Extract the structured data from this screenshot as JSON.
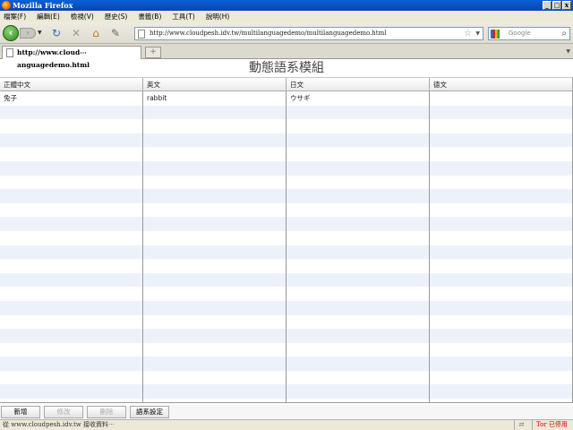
{
  "window": {
    "title": "Mozilla Firefox",
    "minimize": "_",
    "restore": "□",
    "close": "x"
  },
  "menu": [
    "檔案(F)",
    "編輯(E)",
    "檢視(V)",
    "歷史(S)",
    "書籤(B)",
    "工具(T)",
    "說明(H)"
  ],
  "nav": {
    "url": "http://www.cloudpesh.idv.tw/multilanguagedemo/multilanguagedemo.html",
    "search_placeholder": "Google"
  },
  "tab": {
    "label": "http://www.cloud⋯anguagedemo.html",
    "new_tab": "+"
  },
  "app": {
    "title": "動態語系模組",
    "columns": [
      "正體中文",
      "英文",
      "日文",
      "德文"
    ],
    "rows": [
      [
        "兔子",
        "rabbit",
        "ウサギ",
        ""
      ]
    ],
    "buttons": {
      "add": "新增",
      "edit": "修改",
      "delete": "刪除",
      "settings": "語系設定"
    }
  },
  "status": {
    "text": "從 www.cloudpesh.idv.tw 接收資料⋯",
    "tor": "Tor 已停用"
  }
}
